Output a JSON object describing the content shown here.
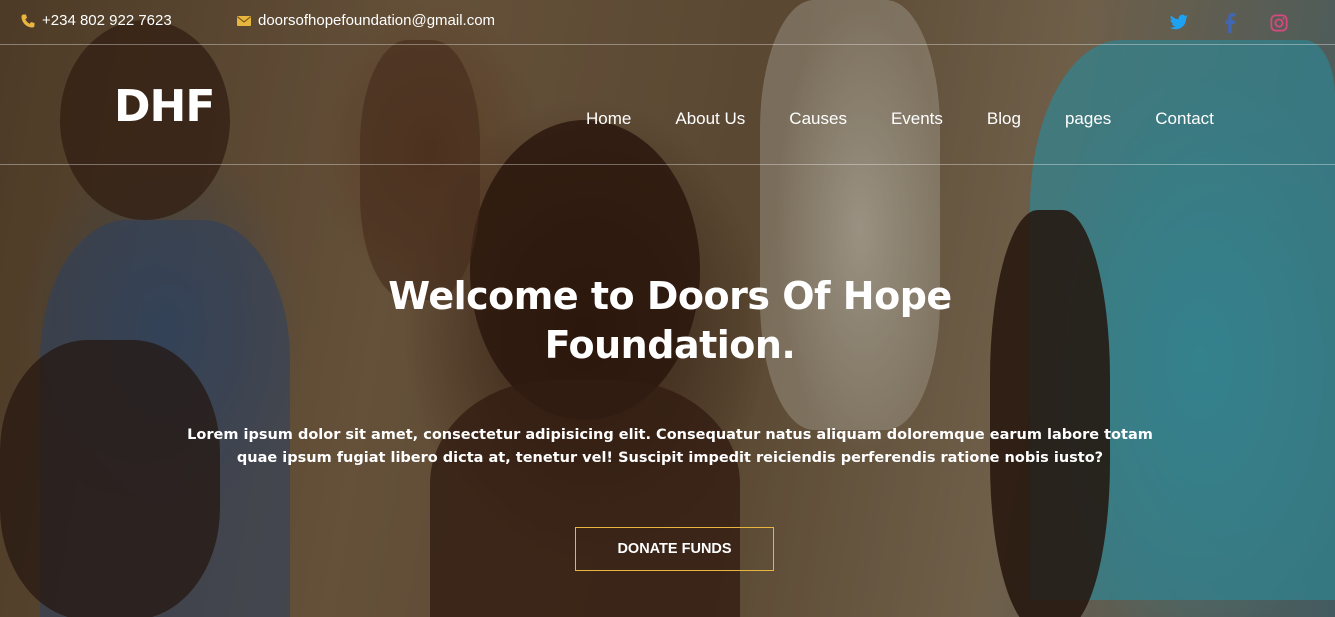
{
  "topbar": {
    "phone": "+234 802 922 7623",
    "email": "doorsofhopefoundation@gmail.com",
    "phone_icon": "phone-icon",
    "email_icon": "envelope-icon",
    "social": [
      {
        "name": "twitter-icon",
        "color": "#1da1f2"
      },
      {
        "name": "facebook-icon",
        "color": "#3b5998"
      },
      {
        "name": "instagram-icon",
        "color": "#c13584"
      }
    ],
    "accent": "#e8b53f"
  },
  "nav": {
    "logo": "DHF",
    "links": [
      "Home",
      "About Us",
      "Causes",
      "Events",
      "Blog",
      "pages",
      "Contact"
    ]
  },
  "hero": {
    "title_line1": "Welcome to Doors Of Hope",
    "title_line2": "Foundation.",
    "text_line1": "Lorem ipsum dolor sit amet, consectetur adipisicing elit. Consequatur natus aliquam doloremque earum labore totam",
    "text_line2": "quae ipsum fugiat libero dicta at, tenetur vel! Suscipit impedit reiciendis perferendis ratione nobis iusto?",
    "button": "DONATE FUNDS"
  }
}
